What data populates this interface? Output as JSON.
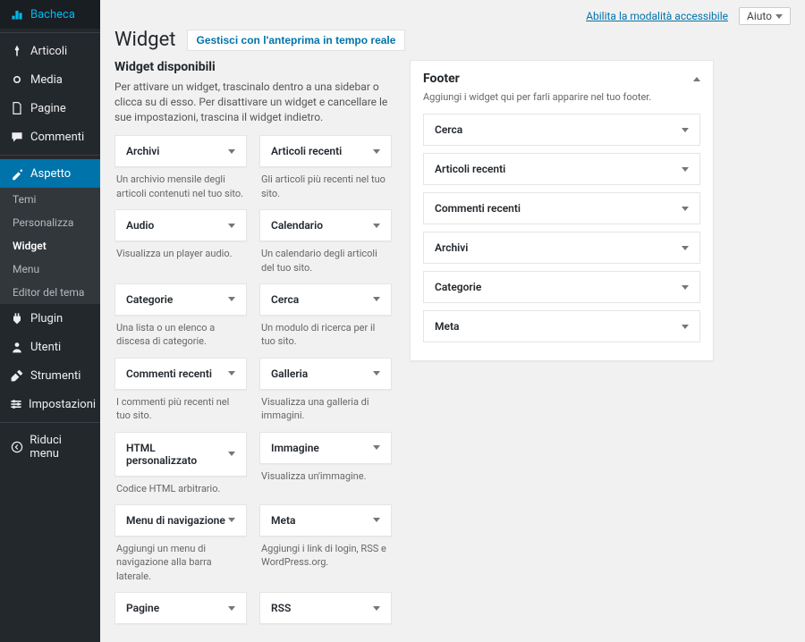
{
  "topbar": {
    "accessibility_link": "Abilita la modalità accessibile",
    "help_label": "Aiuto"
  },
  "titlebar": {
    "title": "Widget",
    "manage_button": "Gestisci con l'anteprima in tempo reale"
  },
  "sidebar": {
    "items": [
      {
        "label": "Bacheca",
        "icon": "dashboard"
      },
      {
        "label": "Articoli",
        "icon": "pin"
      },
      {
        "label": "Media",
        "icon": "media"
      },
      {
        "label": "Pagine",
        "icon": "page"
      },
      {
        "label": "Commenti",
        "icon": "comment"
      },
      {
        "label": "Aspetto",
        "icon": "appearance"
      },
      {
        "label": "Plugin",
        "icon": "plugin"
      },
      {
        "label": "Utenti",
        "icon": "user"
      },
      {
        "label": "Strumenti",
        "icon": "tools"
      },
      {
        "label": "Impostazioni",
        "icon": "settings"
      },
      {
        "label": "Riduci menu",
        "icon": "collapse"
      }
    ],
    "submenu": [
      {
        "label": "Temi"
      },
      {
        "label": "Personalizza"
      },
      {
        "label": "Widget"
      },
      {
        "label": "Menu"
      },
      {
        "label": "Editor del tema"
      }
    ]
  },
  "available": {
    "heading": "Widget disponibili",
    "intro": "Per attivare un widget, trascinalo dentro a una sidebar o clicca su di esso. Per disattivare un widget e cancellare le sue impostazioni, trascina il widget indietro.",
    "widgets": [
      {
        "name": "Archivi",
        "desc": "Un archivio mensile degli articoli contenuti nel tuo sito."
      },
      {
        "name": "Articoli recenti",
        "desc": "Gli articoli più recenti nel tuo sito."
      },
      {
        "name": "Audio",
        "desc": "Visualizza un player audio."
      },
      {
        "name": "Calendario",
        "desc": "Un calendario degli articoli del tuo sito."
      },
      {
        "name": "Categorie",
        "desc": "Una lista o un elenco a discesa di categorie."
      },
      {
        "name": "Cerca",
        "desc": "Un modulo di ricerca per il tuo sito."
      },
      {
        "name": "Commenti recenti",
        "desc": "I commenti più recenti nel tuo sito."
      },
      {
        "name": "Galleria",
        "desc": "Visualizza una galleria di immagini."
      },
      {
        "name": "HTML personalizzato",
        "desc": "Codice HTML arbitrario."
      },
      {
        "name": "Immagine",
        "desc": "Visualizza un'immagine."
      },
      {
        "name": "Menu di navigazione",
        "desc": "Aggiungi un menu di navigazione alla barra laterale."
      },
      {
        "name": "Meta",
        "desc": "Aggiungi i link di login, RSS e WordPress.org."
      },
      {
        "name": "Pagine",
        "desc": ""
      },
      {
        "name": "RSS",
        "desc": ""
      }
    ]
  },
  "footer_area": {
    "title": "Footer",
    "desc": "Aggiungi i widget qui per farli apparire nel tuo footer.",
    "widgets": [
      {
        "name": "Cerca"
      },
      {
        "name": "Articoli recenti"
      },
      {
        "name": "Commenti recenti"
      },
      {
        "name": "Archivi"
      },
      {
        "name": "Categorie"
      },
      {
        "name": "Meta"
      }
    ]
  }
}
